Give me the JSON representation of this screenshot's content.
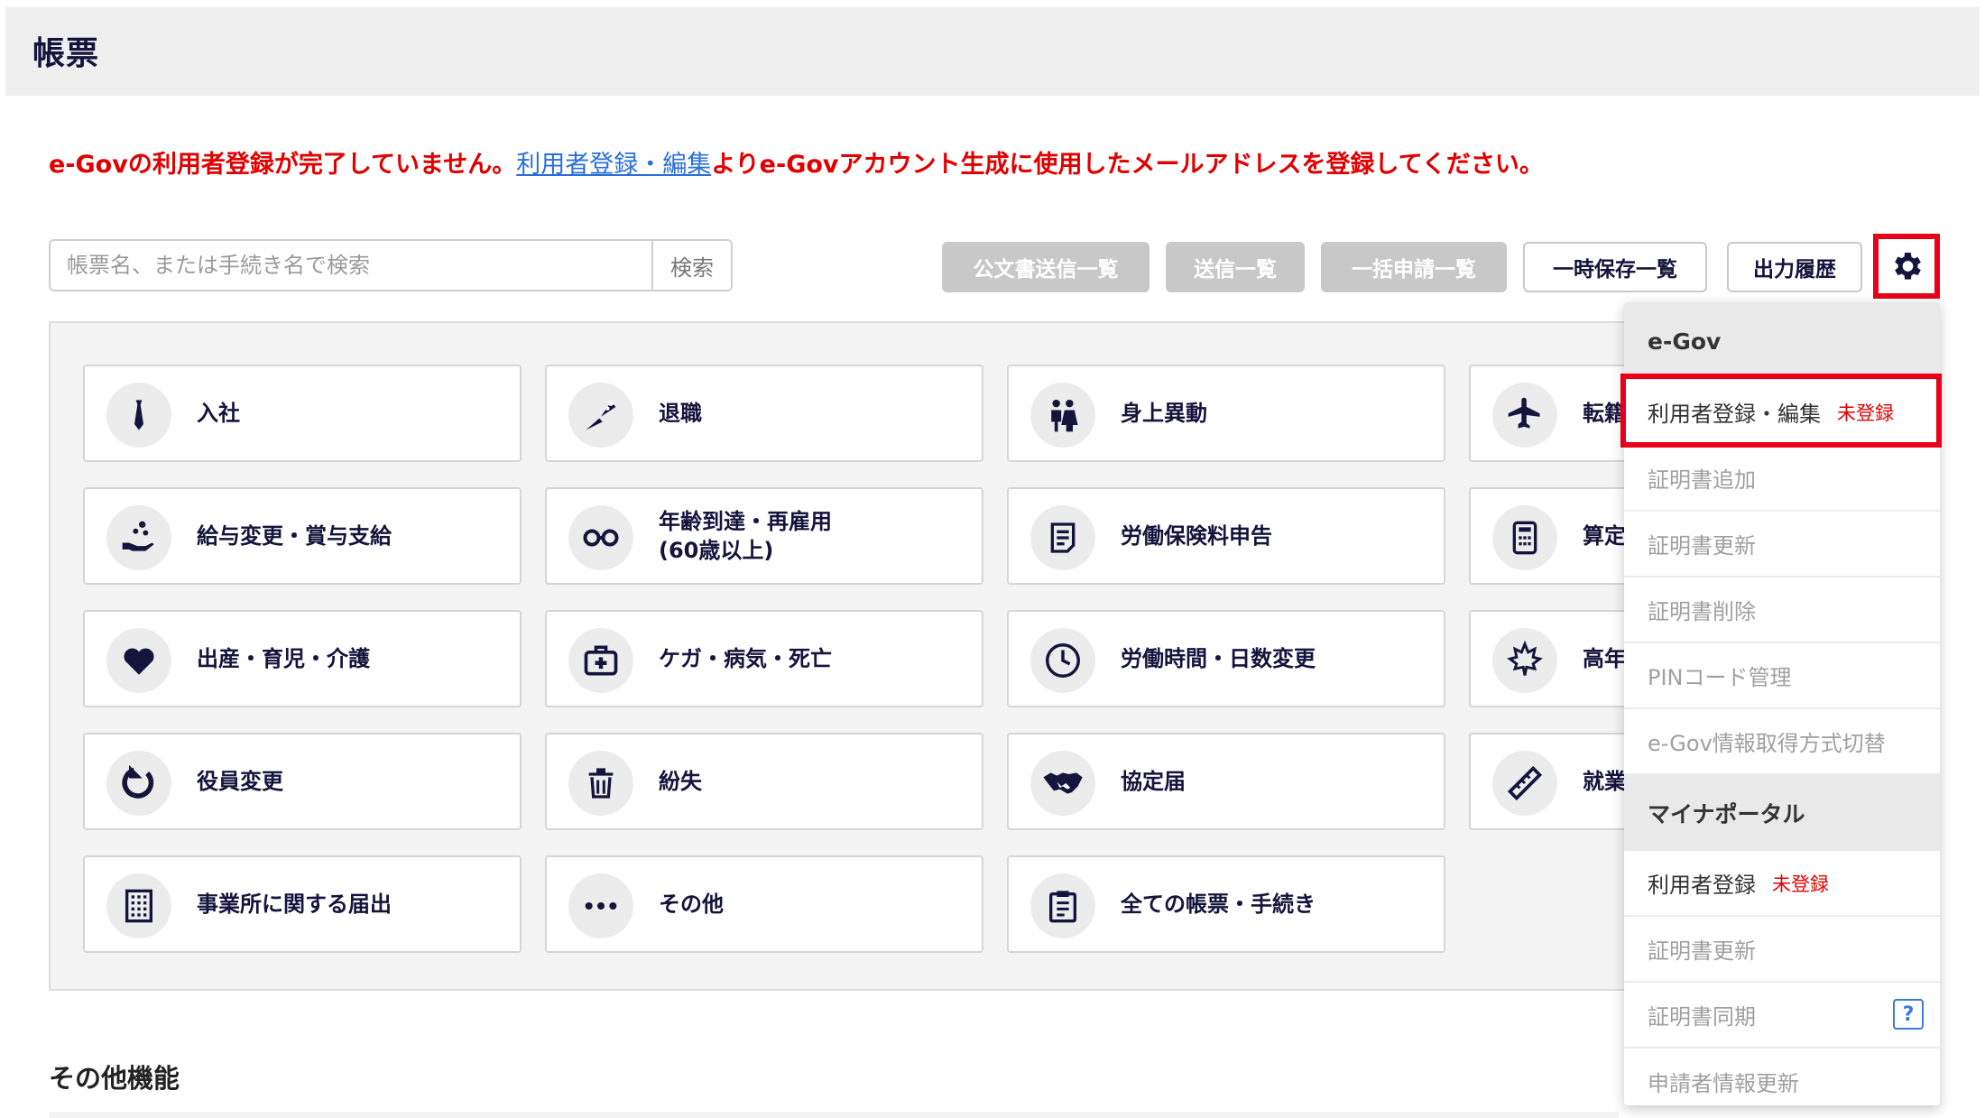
{
  "header": {
    "title": "帳票"
  },
  "alert": {
    "before": "e-Govの利用者登録が完了していません。",
    "link": "利用者登録・編集",
    "after": "よりe-Govアカウント生成に使用したメールアドレスを登録してください。"
  },
  "search": {
    "placeholder": "帳票名、または手続き名で検索",
    "button": "検索"
  },
  "toolbar": {
    "public_docs": "公文書送信一覧",
    "sent": "送信一覧",
    "bulk": "一括申請一覧",
    "temp_saved": "一時保存一覧",
    "output_history": "出力履歴"
  },
  "cards": [
    {
      "label": "入社",
      "icon": "necktie-icon"
    },
    {
      "label": "退職",
      "icon": "bouquet-icon"
    },
    {
      "label": "身上異動",
      "icon": "wedding-couple-icon"
    },
    {
      "label": "転籍",
      "icon": "airplane-icon"
    },
    {
      "label": "給与変更・賞与支給",
      "icon": "coins-hand-icon"
    },
    {
      "label": "年齢到達・再雇用\n(60歳以上)",
      "icon": "glasses-icon"
    },
    {
      "label": "労働保険料申告",
      "icon": "document-icon"
    },
    {
      "label": "算定",
      "icon": "calculator-icon"
    },
    {
      "label": "出産・育児・介護",
      "icon": "heart-icon"
    },
    {
      "label": "ケガ・病気・死亡",
      "icon": "first-aid-icon"
    },
    {
      "label": "労働時間・日数変更",
      "icon": "clock-icon"
    },
    {
      "label": "高年",
      "icon": "maple-leaf-icon"
    },
    {
      "label": "役員変更",
      "icon": "refresh-icon"
    },
    {
      "label": "紛失",
      "icon": "trash-icon"
    },
    {
      "label": "協定届",
      "icon": "handshake-icon"
    },
    {
      "label": "就業",
      "icon": "ruler-icon"
    },
    {
      "label": "事業所に関する届出",
      "icon": "building-icon"
    },
    {
      "label": "その他",
      "icon": "more-icon"
    },
    {
      "label": "全ての帳票・手続き",
      "icon": "clipboard-icon"
    }
  ],
  "other_features": {
    "title": "その他機能"
  },
  "menu": {
    "egov_title": "e-Gov",
    "user_registration": "利用者登録・編集",
    "user_registration_status": "未登録",
    "add_cert": "証明書追加",
    "renew_cert": "証明書更新",
    "delete_cert": "証明書削除",
    "pin_management": "PINコード管理",
    "egov_switch": "e-Gov情報取得方式切替",
    "myna_title": "マイナポータル",
    "myna_user_registration": "利用者登録",
    "myna_user_status": "未登録",
    "myna_renew_cert": "証明書更新",
    "myna_sync_cert": "証明書同期",
    "applicant_update": "申請者情報更新",
    "help_glyph": "?"
  },
  "colors": {
    "accent_red": "#e8001a",
    "navy": "#14143c",
    "link_blue": "#2a6fd8",
    "disabled_gray": "#c8c8c8"
  }
}
